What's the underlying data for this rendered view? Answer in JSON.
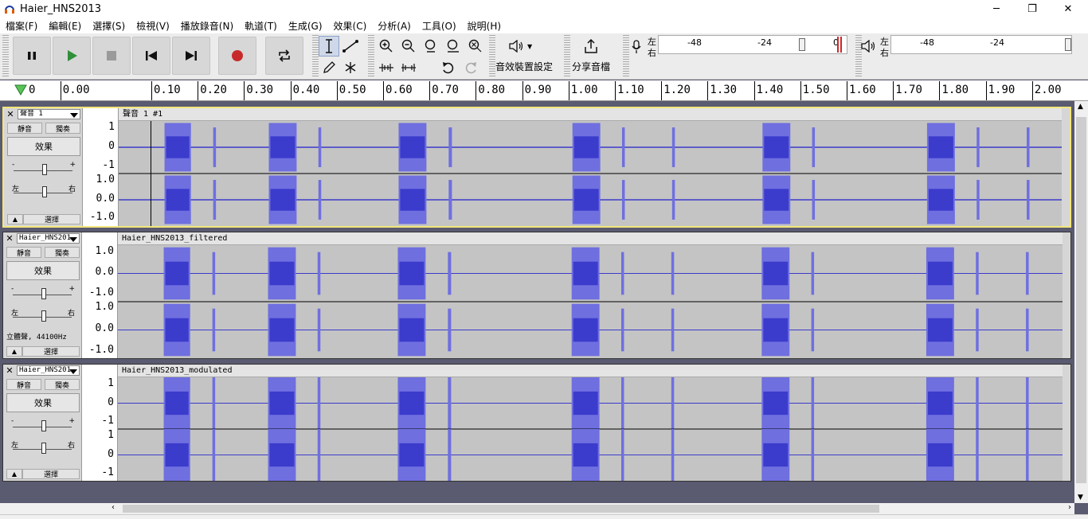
{
  "window": {
    "title": "Haier_HNS2013",
    "min_icon": "minimize-icon",
    "max_icon": "restore-icon",
    "close_icon": "close-icon",
    "min_glyph": "─",
    "max_glyph": "❐",
    "close_glyph": "✕"
  },
  "menu": [
    {
      "label": "檔案(F)"
    },
    {
      "label": "編輯(E)"
    },
    {
      "label": "選擇(S)"
    },
    {
      "label": "檢視(V)"
    },
    {
      "label": "播放錄音(N)"
    },
    {
      "label": "軌道(T)"
    },
    {
      "label": "生成(G)"
    },
    {
      "label": "效果(C)"
    },
    {
      "label": "分析(A)"
    },
    {
      "label": "工具(O)"
    },
    {
      "label": "說明(H)"
    }
  ],
  "toolbar": {
    "transport": [
      "pause-icon",
      "play-icon",
      "stop-icon",
      "skip-start-icon",
      "skip-end-icon",
      "record-icon",
      "loop-icon"
    ],
    "audio_setup_label": "音效裝置設定",
    "share_audio_label": "分享音檔",
    "record_meter": {
      "left_label": "左",
      "right_label": "右",
      "ticks": [
        "-48",
        "-24",
        "0"
      ]
    },
    "play_meter": {
      "left_label": "左",
      "right_label": "右",
      "ticks": [
        "-48",
        "-24"
      ]
    },
    "colors": {
      "record": "#c72a2a",
      "play": "#2f8f3a"
    }
  },
  "ruler": {
    "labels": [
      "0",
      "0.00",
      "0.10",
      "0.20",
      "0.30",
      "0.40",
      "0.50",
      "0.60",
      "0.70",
      "0.80",
      "0.90",
      "1.00",
      "1.10",
      "1.20",
      "1.30",
      "1.40",
      "1.50",
      "1.60",
      "1.70",
      "1.80",
      "1.90",
      "2.00"
    ]
  },
  "tracks": [
    {
      "name": "聲音 1",
      "clip": "聲音 1 #1",
      "mute": "靜音",
      "solo": "獨奏",
      "effects": "效果",
      "left": "左",
      "right": "右",
      "gain_minus": "-",
      "gain_plus": "+",
      "select": "選擇",
      "scale_top": [
        "1",
        "0",
        "-1"
      ],
      "scale_bottom": [
        "1.0",
        "0.0",
        "-1.0"
      ]
    },
    {
      "name": "Haier_HNS201",
      "clip": "Haier_HNS2013_filtered",
      "mute": "靜音",
      "solo": "獨奏",
      "effects": "效果",
      "left": "左",
      "right": "右",
      "gain_minus": "-",
      "gain_plus": "+",
      "rate": "立體聲, 44100Hz",
      "select": "選擇",
      "scale_top": [
        "1.0",
        "0.0",
        "-1.0"
      ],
      "scale_bottom": [
        "1.0",
        "0.0",
        "-1.0"
      ]
    },
    {
      "name": "Haier_HNS201",
      "clip": "Haier_HNS2013_modulated",
      "mute": "靜音",
      "solo": "獨奏",
      "effects": "效果",
      "left": "左",
      "right": "右",
      "gain_minus": "-",
      "gain_plus": "+",
      "select": "選擇",
      "scale_top": [
        "1",
        "0",
        "-1"
      ],
      "scale_bottom": [
        "1",
        "0",
        "-1"
      ]
    }
  ],
  "waveform": {
    "color": "#3b3bcc",
    "fill": "#6f6fe0",
    "bursts_sec": [
      {
        "start": 0.025,
        "end": 0.082
      },
      {
        "start": 0.13,
        "end": 0.136
      },
      {
        "start": 0.25,
        "end": 0.31
      },
      {
        "start": 0.357,
        "end": 0.363
      },
      {
        "start": 0.53,
        "end": 0.59
      },
      {
        "start": 0.638,
        "end": 0.645
      },
      {
        "start": 0.905,
        "end": 0.965
      },
      {
        "start": 1.012,
        "end": 1.018
      },
      {
        "start": 1.12,
        "end": 1.126
      },
      {
        "start": 1.315,
        "end": 1.375
      },
      {
        "start": 1.422,
        "end": 1.428
      },
      {
        "start": 1.67,
        "end": 1.73
      },
      {
        "start": 1.777,
        "end": 1.783
      },
      {
        "start": 1.885,
        "end": 1.891
      }
    ]
  }
}
